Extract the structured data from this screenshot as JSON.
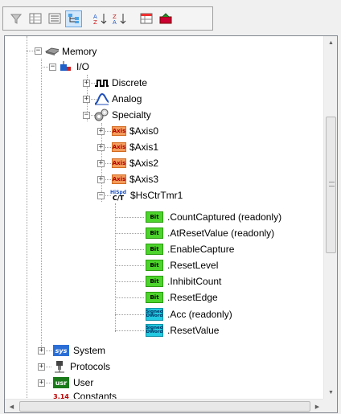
{
  "toolbar": {
    "buttons": [
      {
        "name": "filter-icon",
        "glyph": "⛉"
      },
      {
        "name": "grid-view-icon",
        "glyph": "▦"
      },
      {
        "name": "list-view-icon",
        "glyph": "≣"
      },
      {
        "name": "tree-view-icon",
        "glyph": "⊞"
      },
      {
        "name": "sort-ascending-icon",
        "glyph": "⇅"
      },
      {
        "name": "sort-descending-icon",
        "glyph": "⇵"
      },
      {
        "name": "properties-icon",
        "glyph": "▤"
      },
      {
        "name": "export-icon",
        "glyph": "⌂"
      }
    ]
  },
  "tree": {
    "memory": "Memory",
    "io": "I/O",
    "discrete": "Discrete",
    "analog": "Analog",
    "specialty": "Specialty",
    "axis0": "$Axis0",
    "axis1": "$Axis1",
    "axis2": "$Axis2",
    "axis3": "$Axis3",
    "hsctr": "$HsCtrTmr1",
    "count_captured": ".CountCaptured (readonly)",
    "at_reset": ".AtResetValue (readonly)",
    "enable_capture": ".EnableCapture",
    "reset_level": ".ResetLevel",
    "inhibit_count": ".InhibitCount",
    "reset_edge": ".ResetEdge",
    "acc": ".Acc (readonly)",
    "reset_value": ".ResetValue",
    "system": "System",
    "protocols": "Protocols",
    "user": "User",
    "constants": "Constants"
  },
  "badges": {
    "axis": "Axis",
    "bit": "Bit",
    "signed_top": "Signed",
    "signed_bottom": "DWord",
    "hispd_top": "HiSpd",
    "hispd_bottom": "C/T",
    "sys": "sys",
    "usr": "usr",
    "const": "3.14"
  },
  "colors": {
    "axis_bg": "#f39b5c",
    "bit_bg": "#4dd42c",
    "signed_bg": "#23c9e0",
    "sys_bg": "#2b6fd6",
    "usr_bg": "#1a7a1a"
  }
}
